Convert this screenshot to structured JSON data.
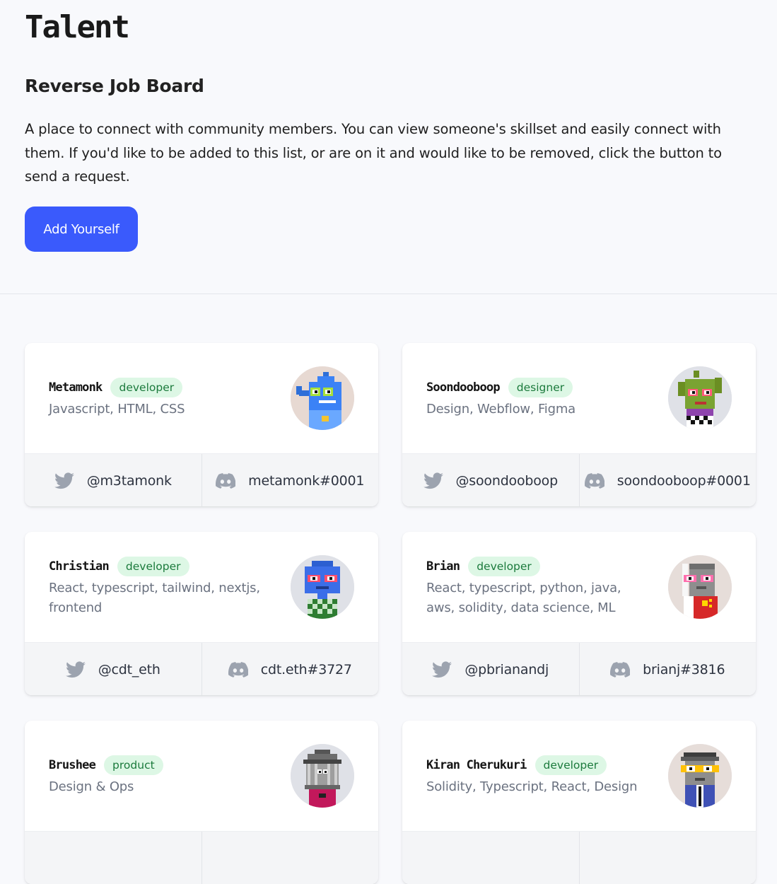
{
  "page": {
    "title": "Talent",
    "subtitle": "Reverse Job Board",
    "description": "A place to connect with community members. You can view someone's skillset and easily connect with them. If you'd like to be added to this list, or are on it and would like to be removed, click the button to send a request.",
    "add_button_label": "Add Yourself"
  },
  "colors": {
    "accent": "#3a5afc",
    "badge_bg": "#ddf7e5",
    "badge_text": "#1b7a3c",
    "social_icon": "#9ca3af"
  },
  "members": [
    {
      "name": "Metamonk",
      "role": "developer",
      "skills": "Javascript, HTML, CSS",
      "twitter": "@m3tamonk",
      "discord": "metamonk#0001",
      "avatar_icon": "pixel-shark-avatar-icon",
      "avatar_bg": "#e7d9d2"
    },
    {
      "name": "Soondooboop",
      "role": "designer",
      "skills": "Design, Webflow, Figma",
      "twitter": "@soondooboop",
      "discord": "soondooboop#0001",
      "avatar_icon": "pixel-cactus-avatar-icon",
      "avatar_bg": "#dfe1e7"
    },
    {
      "name": "Christian",
      "role": "developer",
      "skills": "React, typescript, tailwind, nextjs, frontend",
      "twitter": "@cdt_eth",
      "discord": "cdt.eth#3727",
      "avatar_icon": "pixel-blue-creature-avatar-icon",
      "avatar_bg": "#dfe1e7"
    },
    {
      "name": "Brian",
      "role": "developer",
      "skills": "React, typescript, python, java, aws, solidity, data science, ML",
      "twitter": "@pbrianandj",
      "discord": "brianj#3816",
      "avatar_icon": "pixel-gray-character-avatar-icon",
      "avatar_bg": "#e6ddd9"
    },
    {
      "name": "Brushee",
      "role": "product",
      "skills": "Design & Ops",
      "twitter": "",
      "discord": "",
      "avatar_icon": "pixel-temple-avatar-icon",
      "avatar_bg": "#dfe1e7"
    },
    {
      "name": "Kiran Cherukuri",
      "role": "developer",
      "skills": "Solidity, Typescript, React, Design",
      "twitter": "",
      "discord": "",
      "avatar_icon": "pixel-hat-character-avatar-icon",
      "avatar_bg": "#e6ddd9"
    }
  ]
}
